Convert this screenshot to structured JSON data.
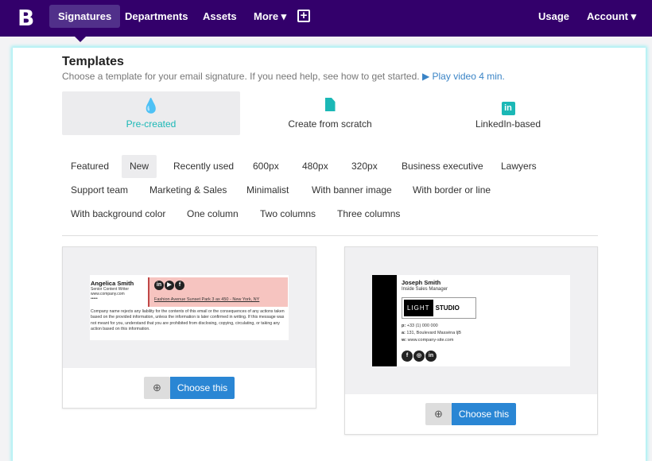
{
  "nav": {
    "logo": "B",
    "items": [
      "Signatures",
      "Departments",
      "Assets",
      "More ▾"
    ],
    "usage": "Usage",
    "account": "Account ▾"
  },
  "header": {
    "title": "Templates",
    "subtitle": "Choose a template for your email signature. If you need help, see how to get started.",
    "video_link": "Play video 4 min."
  },
  "sources": [
    {
      "label": "Pre-created",
      "icon": "droplet-icon"
    },
    {
      "label": "Create from scratch",
      "icon": "file-icon"
    },
    {
      "label": "LinkedIn-based",
      "icon": "linkedin-icon"
    }
  ],
  "filters": [
    "Featured",
    "New",
    "Recently used",
    "600px",
    "480px",
    "320px",
    "Business executive",
    "Lawyers",
    "Support team",
    "Marketing & Sales",
    "Minimalist",
    "With banner image",
    "With border or line",
    "With background color",
    "One column",
    "Two columns",
    "Three columns"
  ],
  "templates": [
    {
      "name": "Angelica Smith",
      "role": "Senior Content Writer",
      "site": "www.company.com",
      "dots": "•••••",
      "address": "Fashion Avenue Sunset Park 3 ax 450 - New York, NY",
      "disclaimer": "Company name rejects any liability for the contents of this email or the consequences of any actions taken based on the provided information, unless the information is later confirmed in writing. If this message was not meant for you, understand that you are prohibited from disclosing, copying, circulating, or taking any action based on this information.",
      "button": "Choose this"
    },
    {
      "name": "Joseph Smith",
      "role": "Inside Sales Manager",
      "logo_a": "LIGHT",
      "logo_b": "STUDIO",
      "phone_label": "p:",
      "phone": "+33 (1) 000 000",
      "addr_label": "a:",
      "address": "131, Boulevard Masséna ljB",
      "web_label": "w:",
      "web": "www.company-site.com",
      "button": "Choose this"
    }
  ]
}
